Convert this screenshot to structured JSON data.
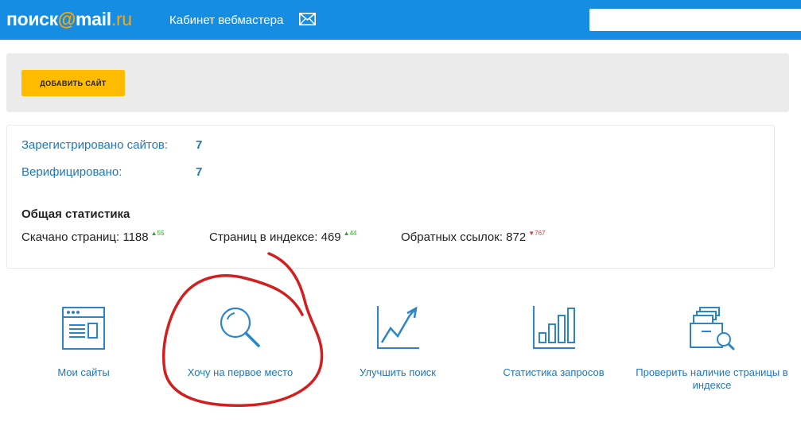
{
  "header": {
    "logo_part1": "поиск",
    "logo_at": "@",
    "logo_part2": "mail",
    "logo_dot": ".",
    "logo_ru": "ru",
    "title": "Кабинет вебмастера",
    "mail_icon": "envelope-icon",
    "search_value": ""
  },
  "add_panel": {
    "button_label": "ДОБАВИТЬ САЙТ"
  },
  "summary": {
    "registered_label": "Зарегистрировано сайтов:",
    "registered_value": "7",
    "verified_label": "Верифицировано:",
    "verified_value": "7"
  },
  "stats": {
    "title": "Общая статистика",
    "downloaded_label": "Скачано страниц: ",
    "downloaded_value": "1188",
    "downloaded_delta": "▲55",
    "indexed_label": "Страниц в индексе: ",
    "indexed_value": "469",
    "indexed_delta": "▲44",
    "backlinks_label": "Обратных ссылок: ",
    "backlinks_value": "872",
    "backlinks_delta": "▼767"
  },
  "tools": [
    {
      "label": "Мои сайты",
      "icon": "website-window-icon"
    },
    {
      "label": "Хочу на первое место",
      "icon": "magnifier-icon"
    },
    {
      "label": "Улучшить поиск",
      "icon": "growth-chart-icon"
    },
    {
      "label": "Статистика запросов",
      "icon": "bar-chart-icon"
    },
    {
      "label": "Проверить наличие страницы в индексе",
      "icon": "index-check-icon"
    }
  ],
  "colors": {
    "header_bg": "#168de2",
    "accent_blue": "#2177bd",
    "button_yellow": "#ffbb00",
    "annotation_red": "#d21f1f"
  }
}
